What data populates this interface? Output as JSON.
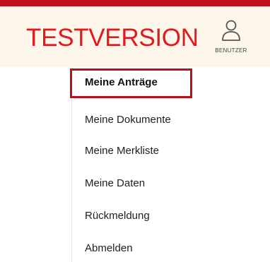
{
  "header": {
    "brand": "TESTVERSION",
    "user_button": {
      "icon": "user-icon",
      "label": "BENUTZER"
    }
  },
  "menu": {
    "items": [
      {
        "label": "Meine Anträge",
        "active": true
      },
      {
        "label": "Meine Dokumente",
        "active": false
      },
      {
        "label": "Meine Merkliste",
        "active": false
      },
      {
        "label": "Meine Daten",
        "active": false
      },
      {
        "label": "Rückmeldung",
        "active": false
      },
      {
        "label": "Abmelden",
        "active": false
      }
    ]
  },
  "colors": {
    "top_bar": "#c40d1e",
    "header_background": "#fdf6ea",
    "brand_text": "#e3191d",
    "highlight_border": "#b5121b"
  }
}
